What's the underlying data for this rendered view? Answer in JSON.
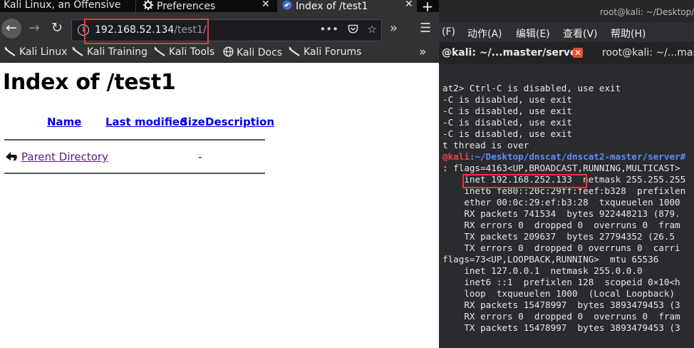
{
  "browser": {
    "tabs": [
      {
        "label": "Kali Linux, an Offensive "
      },
      {
        "label": "Preferences"
      },
      {
        "label": "Index of /test1"
      }
    ],
    "url": {
      "host": "192.168.52.134",
      "path": "/test1/"
    },
    "bookmarks": [
      {
        "label": "Kali Linux"
      },
      {
        "label": "Kali Training"
      },
      {
        "label": "Kali Tools"
      },
      {
        "label": "Kali Docs"
      },
      {
        "label": "Kali Forums"
      }
    ],
    "page": {
      "heading": "Index of /test1",
      "columns": [
        "Name",
        "Last modified",
        "Size",
        "Description"
      ],
      "rows": [
        {
          "name": "Parent Directory",
          "size": "-"
        }
      ]
    }
  },
  "terminal": {
    "window_title": "root@kali: ~/Desktop/dr",
    "menu": [
      "(F)",
      "动作(A)",
      "编辑(E)",
      "查看(V)",
      "帮助(H)"
    ],
    "tabs": [
      {
        "label": "@kali: ~/...master/server"
      },
      {
        "label": "root@kali: ~/...master"
      }
    ],
    "lines": [
      "at2> Ctrl-C is disabled, use exit",
      "-C is disabled, use exit",
      "-C is disabled, use exit",
      "-C is disabled, use exit",
      "-C is disabled, use exit",
      "",
      "t thread is over",
      "",
      ": flags=4163<UP,BROADCAST,RUNNING,MULTICAST>",
      "    inet 192.168.252.133  netmask 255.255.255",
      "    inet6 fe80::20c:29ff:feef:b328  prefixlen",
      "    ether 00:0c:29:ef:b3:28  txqueuelen 1000",
      "    RX packets 741534  bytes 922448213 (879.",
      "    RX errors 0  dropped 0  overruns 0  fram",
      "    TX packets 209637  bytes 27794352 (26.5",
      "    TX errors 0  dropped 0 overruns 0  carri",
      "",
      "flags=73<UP,LOOPBACK,RUNNING>  mtu 65536",
      "    inet 127.0.0.1  netmask 255.0.0.0",
      "    inet6 ::1  prefixlen 128  scopeid 0×10<h",
      "    loop  txqueuelen 1000  (Local Loopback)",
      "    RX packets 15478997  bytes 3893479453 (3",
      "    RX errors 0  dropped 0  overruns 0  fram",
      "    TX packets 15478997  bytes 3893479453 (3"
    ],
    "prompt": {
      "user": "@kali",
      "path": ":~/Desktop/dnscat/dnscat2-master/server#"
    }
  },
  "colors": {
    "highlight": "#e53935",
    "link": "#0000ee",
    "visited": "#551a8b",
    "prompt_user": "#e64747",
    "prompt_path": "#5a8dff"
  }
}
